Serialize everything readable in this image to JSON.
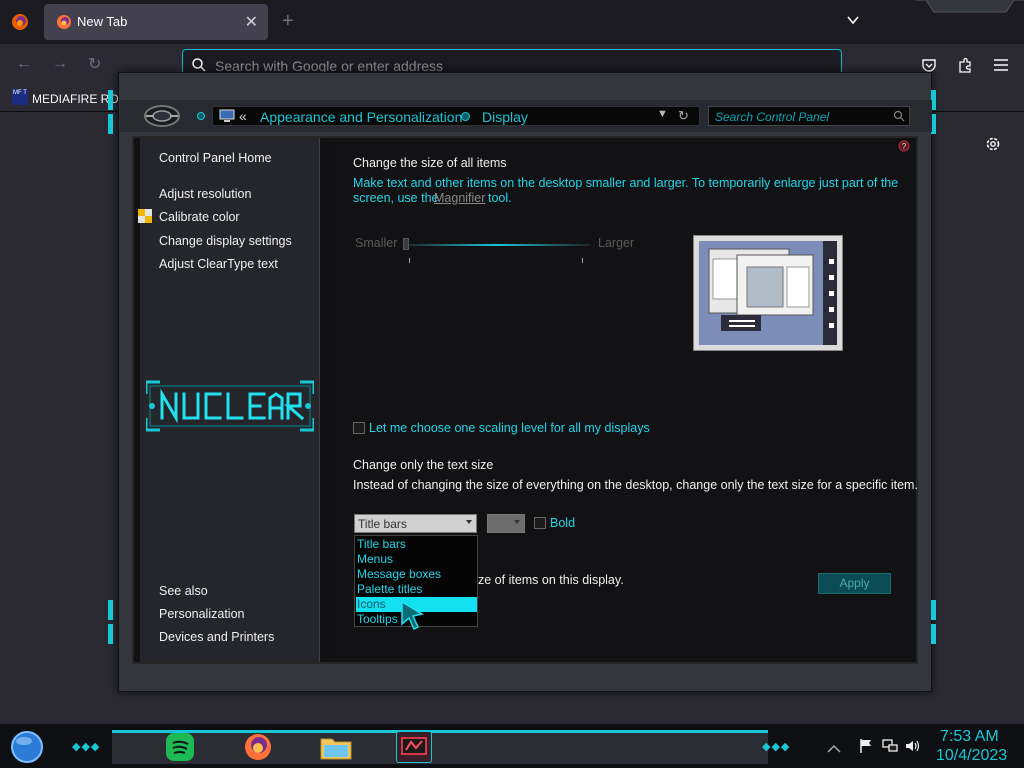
{
  "browser": {
    "tab_label": "New Tab",
    "new_tab_symbol": "+",
    "close_symbol": "✕",
    "address_placeholder": "Search with Google or enter address",
    "bookmark_label": "MEDIAFIRE RO",
    "bookmark_icon_text": "MF T"
  },
  "control_panel": {
    "breadcrumb_chevron": "«",
    "breadcrumb": [
      "Appearance and Personalization",
      "Display"
    ],
    "search_placeholder": "Search Control Panel",
    "sidebar": {
      "home": "Control Panel Home",
      "links": [
        "Adjust resolution",
        "Calibrate color",
        "Change display settings",
        "Adjust ClearType text"
      ],
      "see_also": "See also",
      "see_also_links": [
        "Personalization",
        "Devices and Printers"
      ]
    },
    "content": {
      "heading": "Change the size of all items",
      "desc_line1": "Make text and other items on the desktop smaller and larger. To temporarily enlarge just part of the",
      "desc_line2_pre": "screen, use the",
      "magnifier_link": "Magnifier",
      "desc_line2_post": "tool.",
      "smaller": "Smaller",
      "larger": "Larger",
      "slider_level": 0,
      "scaling_checkbox": "Let me choose one scaling level for all my displays",
      "text_size_heading": "Change only the text size",
      "text_size_desc": "Instead of changing the size of everything on the desktop, change only the text size for a specific item.",
      "item_select_value": "Title bars",
      "size_select_value": "",
      "bold_label": "Bold",
      "dropdown_items": [
        "Title bars",
        "Menus",
        "Message boxes",
        "Palette titles",
        "Icons",
        "Tooltips"
      ],
      "dropdown_selected": "Icons",
      "hidden_text_tail": "ze of items on this display.",
      "apply": "Apply"
    }
  },
  "taskbar": {
    "time": "7:53 AM",
    "date": "10/4/2023"
  },
  "colors": {
    "accent": "#19c6d6",
    "browser_bg": "#1c1b22"
  }
}
